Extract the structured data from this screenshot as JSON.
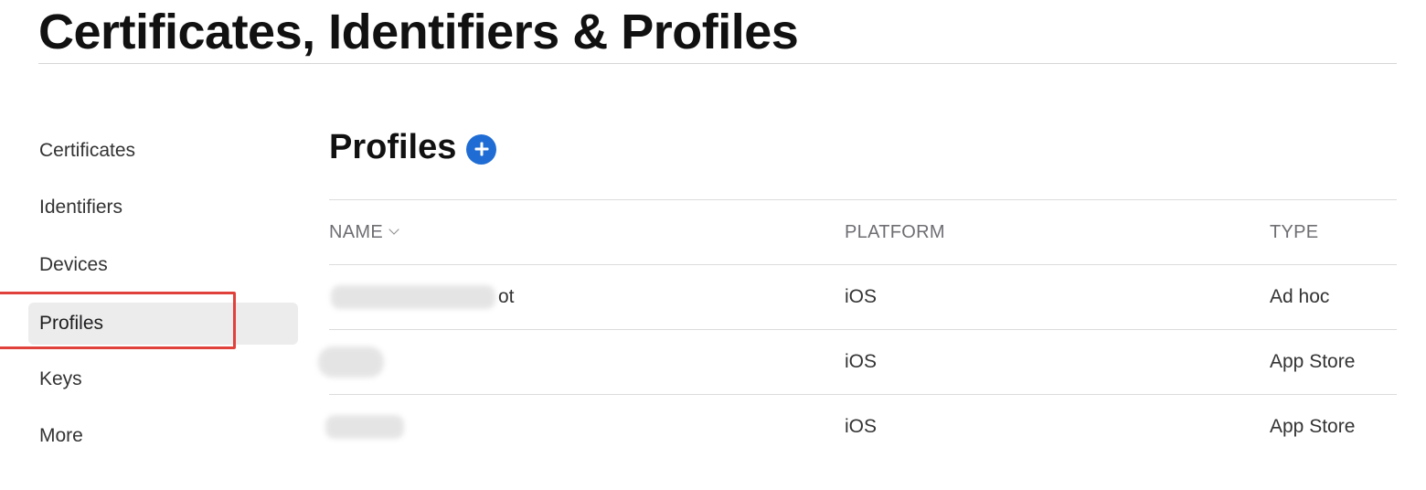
{
  "header": {
    "title": "Certificates, Identifiers & Profiles"
  },
  "sidebar": {
    "items": [
      {
        "label": "Certificates",
        "active": false
      },
      {
        "label": "Identifiers",
        "active": false
      },
      {
        "label": "Devices",
        "active": false
      },
      {
        "label": "Profiles",
        "active": true
      },
      {
        "label": "Keys",
        "active": false
      },
      {
        "label": "More",
        "active": false
      }
    ]
  },
  "main": {
    "section_title": "Profiles",
    "add_icon": "plus-circle-icon",
    "accent_color": "#1f6dd4",
    "highlight_color": "#e0413a",
    "table": {
      "columns": [
        "NAME",
        "PLATFORM",
        "TYPE"
      ],
      "sort_icon": "chevron-down-icon",
      "rows": [
        {
          "name_visible": "ot",
          "name_redacted": true,
          "platform": "iOS",
          "type": "Ad hoc"
        },
        {
          "name_visible": "",
          "name_redacted": true,
          "platform": "iOS",
          "type": "App Store"
        },
        {
          "name_visible": "",
          "name_redacted": true,
          "platform": "iOS",
          "type": "App Store"
        }
      ]
    }
  }
}
